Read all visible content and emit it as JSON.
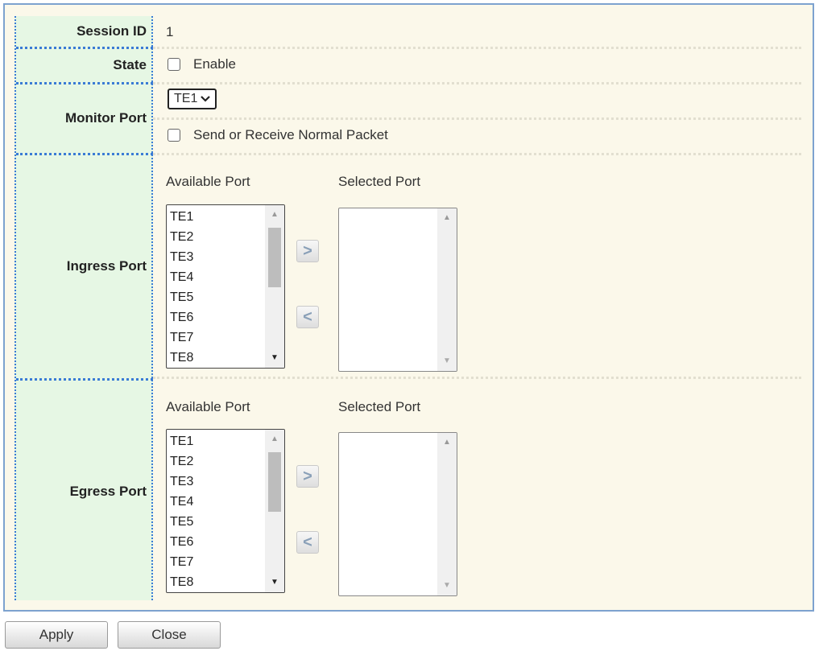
{
  "form": {
    "session_id": {
      "label": "Session ID",
      "value": "1"
    },
    "state": {
      "label": "State",
      "checkbox_label": "Enable",
      "checked": false
    },
    "monitor_port": {
      "label": "Monitor Port",
      "selected": "TE1",
      "normal_packet_label": "Send or Receive Normal Packet",
      "normal_packet_checked": false
    },
    "ingress_port": {
      "label": "Ingress Port",
      "available_header": "Available Port",
      "selected_header": "Selected Port",
      "available_items": [
        "TE1",
        "TE2",
        "TE3",
        "TE4",
        "TE5",
        "TE6",
        "TE7",
        "TE8"
      ],
      "add_symbol": ">",
      "remove_symbol": "<"
    },
    "egress_port": {
      "label": "Egress Port",
      "available_header": "Available Port",
      "selected_header": "Selected Port",
      "available_items": [
        "TE1",
        "TE2",
        "TE3",
        "TE4",
        "TE5",
        "TE6",
        "TE7",
        "TE8"
      ],
      "add_symbol": ">",
      "remove_symbol": "<"
    }
  },
  "buttons": {
    "apply": "Apply",
    "close": "Close"
  },
  "colors": {
    "label_bg": "#e6f7e4",
    "panel_bg": "#fbf8ea",
    "panel_border": "#7da2cf",
    "dotted": "#3a7bd5"
  }
}
